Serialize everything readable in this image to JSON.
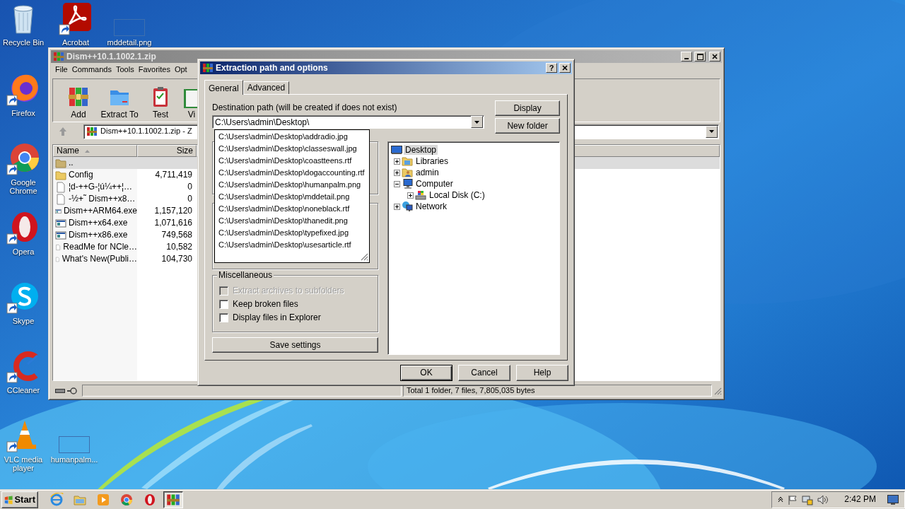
{
  "desktop_icons": [
    {
      "label": "Recycle Bin",
      "kind": "trash",
      "shortcut": false
    },
    {
      "label": "Acrobat",
      "kind": "pdf",
      "shortcut": true
    },
    {
      "label": "mddetail.png",
      "kind": "thumb",
      "shortcut": false
    },
    {
      "label": "Firefox",
      "kind": "firefox",
      "shortcut": true
    },
    {
      "label": "Google Chrome",
      "kind": "chrome",
      "shortcut": true
    },
    {
      "label": "Opera",
      "kind": "opera",
      "shortcut": true
    },
    {
      "label": "Skype",
      "kind": "skype",
      "shortcut": true
    },
    {
      "label": "CCleaner",
      "kind": "ccleaner",
      "shortcut": true
    },
    {
      "label": "VLC media player",
      "kind": "vlc",
      "shortcut": true
    },
    {
      "label": "humanpalm...",
      "kind": "thumb",
      "shortcut": false
    }
  ],
  "archive_window": {
    "title": "Dism++10.1.1002.1.zip",
    "menu": [
      "File",
      "Commands",
      "Tools",
      "Favorites",
      "Opt"
    ],
    "toolbar": [
      {
        "label": "Add",
        "kind": "add"
      },
      {
        "label": "Extract To",
        "kind": "extract"
      },
      {
        "label": "Test",
        "kind": "test"
      },
      {
        "label": "Vi",
        "kind": "view"
      }
    ],
    "address": "Dism++10.1.1002.1.zip - Z",
    "columns": [
      {
        "label": "Name",
        "sorted": true
      },
      {
        "label": "Size",
        "sorted": false
      }
    ],
    "rows": [
      {
        "name": "..",
        "kind": "up",
        "selected": true
      },
      {
        "name": "Config",
        "size": "4,711,419",
        "kind": "folder",
        "selected": false
      },
      {
        "name": "¦d-++G-¦ú¼++¦…",
        "size": "0",
        "kind": "text",
        "selected": false
      },
      {
        "name": "-½+˜ Dism++x8…",
        "size": "0",
        "kind": "text",
        "selected": false
      },
      {
        "name": "Dism++ARM64.exe",
        "size": "1,157,120",
        "kind": "exe",
        "selected": false
      },
      {
        "name": "Dism++x64.exe",
        "size": "1,071,616",
        "kind": "exe",
        "selected": false
      },
      {
        "name": "Dism++x86.exe",
        "size": "749,568",
        "kind": "exe",
        "selected": false
      },
      {
        "name": "ReadMe for NCle…",
        "size": "10,582",
        "kind": "text",
        "selected": false
      },
      {
        "name": "What's New(Publi…",
        "size": "104,730",
        "kind": "text",
        "selected": false
      }
    ],
    "status": "Total 1 folder, 7 files, 7,805,035 bytes"
  },
  "dialog": {
    "title": "Extraction path and options",
    "help": "?",
    "tabs": [
      {
        "label": "General",
        "selected": true
      },
      {
        "label": "Advanced",
        "selected": false
      }
    ],
    "destination_label": "Destination path (will be created if does not exist)",
    "destination_value": "C:\\Users\\admin\\Desktop\\",
    "suggestions": [
      "C:\\Users\\admin\\Desktop\\addradio.jpg",
      "C:\\Users\\admin\\Desktop\\classeswall.jpg",
      "C:\\Users\\admin\\Desktop\\coastteens.rtf",
      "C:\\Users\\admin\\Desktop\\dogaccounting.rtf",
      "C:\\Users\\admin\\Desktop\\humanpalm.png",
      "C:\\Users\\admin\\Desktop\\mddetail.png",
      "C:\\Users\\admin\\Desktop\\noneblack.rtf",
      "C:\\Users\\admin\\Desktop\\thanedit.png",
      "C:\\Users\\admin\\Desktop\\typefixed.jpg",
      "C:\\Users\\admin\\Desktop\\usesarticle.rtf"
    ],
    "misc_title": "Miscellaneous",
    "options": [
      {
        "label": "Extract archives to subfolders",
        "checked": false,
        "disabled": true
      },
      {
        "label": "Keep broken files",
        "checked": false,
        "disabled": false
      },
      {
        "label": "Display files in Explorer",
        "checked": false,
        "disabled": false
      }
    ],
    "save_button": "Save settings",
    "side_buttons": [
      "Display",
      "New folder"
    ],
    "tree": [
      {
        "label": "Desktop",
        "kind": "desktop",
        "selected": true,
        "children": [
          {
            "label": "Libraries",
            "kind": "libraries",
            "expanded": false,
            "selected": false
          },
          {
            "label": "admin",
            "kind": "user",
            "expanded": false,
            "selected": false
          },
          {
            "label": "Computer",
            "kind": "computer",
            "expanded": true,
            "selected": false,
            "children": [
              {
                "label": "Local Disk (C:)",
                "kind": "disk",
                "expanded": false,
                "selected": false
              }
            ]
          },
          {
            "label": "Network",
            "kind": "network",
            "expanded": false,
            "selected": false
          }
        ]
      }
    ],
    "buttons": [
      {
        "label": "OK",
        "default": true
      },
      {
        "label": "Cancel",
        "default": false
      },
      {
        "label": "Help",
        "default": false
      }
    ]
  },
  "taskbar": {
    "start": "Start",
    "apps": [
      {
        "kind": "ie",
        "selected": false
      },
      {
        "kind": "explorer",
        "selected": false
      },
      {
        "kind": "media",
        "selected": false
      },
      {
        "kind": "chrome",
        "selected": false
      },
      {
        "kind": "opera",
        "selected": false
      },
      {
        "kind": "rar",
        "selected": true
      }
    ],
    "clock": "2:42 PM"
  }
}
